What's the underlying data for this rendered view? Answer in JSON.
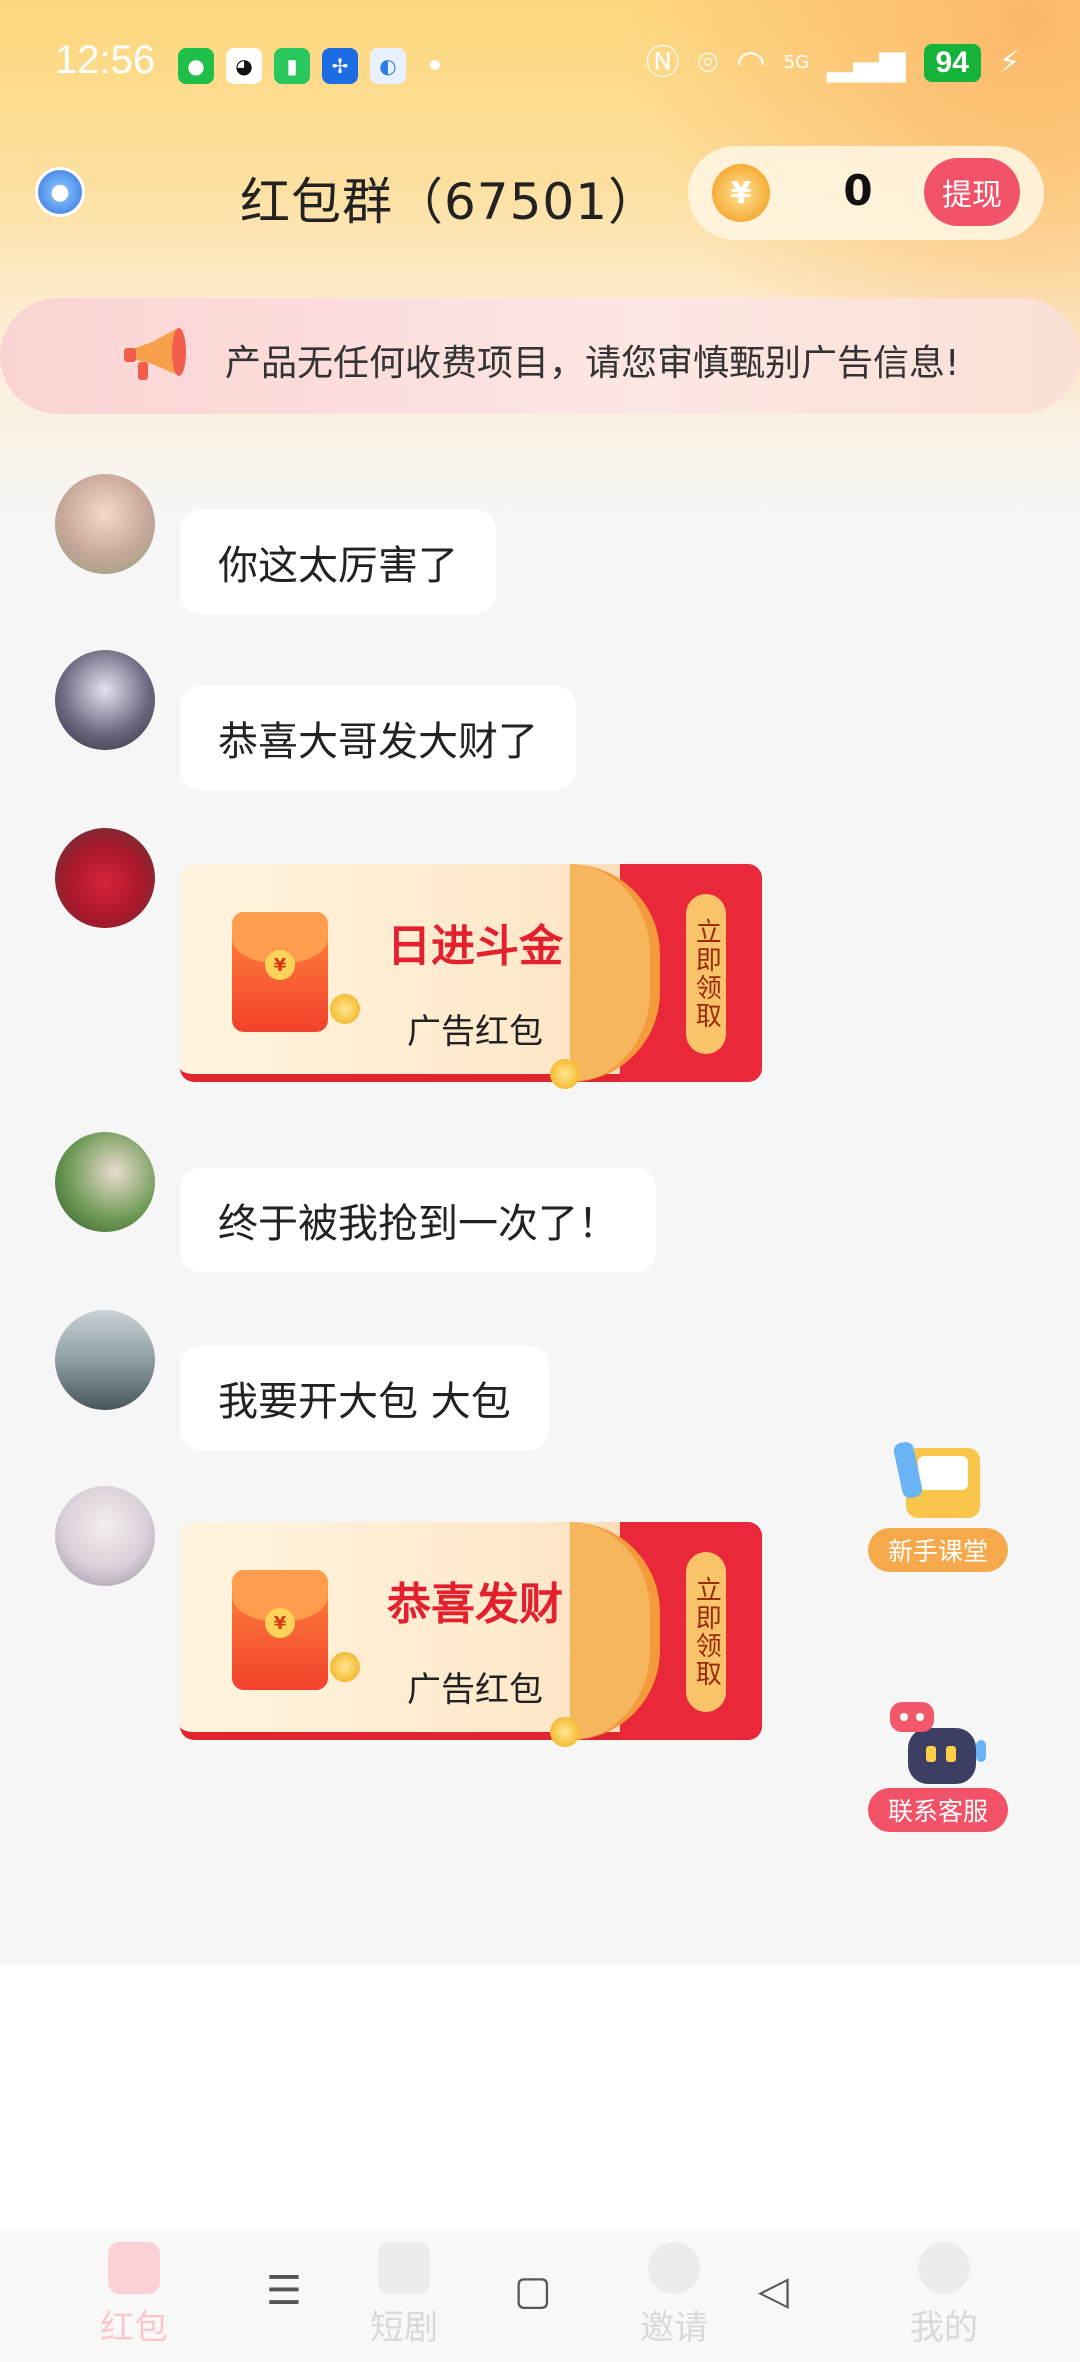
{
  "status_bar": {
    "time": "12:56",
    "battery": "94",
    "network": "5G"
  },
  "header": {
    "title": "红包群（67501）",
    "balance": "0",
    "withdraw_label": "提现"
  },
  "notice": {
    "text": "产品无任何收费项目，请您审慎甄别广告信息!"
  },
  "messages": [
    {
      "type": "text",
      "text": "你这太厉害了"
    },
    {
      "type": "text",
      "text": "恭喜大哥发大财了"
    },
    {
      "type": "packet",
      "title": "日进斗金",
      "subtitle": "广告红包",
      "button": "立即领取"
    },
    {
      "type": "text",
      "text": "终于被我抢到一次了！"
    },
    {
      "type": "text",
      "text": "我要开大包 大包"
    },
    {
      "type": "packet",
      "title": "恭喜发财",
      "subtitle": "广告红包",
      "button": "立即领取"
    }
  ],
  "floating": {
    "tutorial_label": "新手课堂",
    "support_label": "联系客服"
  },
  "tabs": [
    {
      "label": "红包",
      "icon": "red-packet-icon",
      "active": true
    },
    {
      "label": "短剧",
      "icon": "clapper-icon",
      "active": false
    },
    {
      "label": "邀请",
      "icon": "invite-user-icon",
      "active": false
    },
    {
      "label": "我的",
      "icon": "profile-icon",
      "active": false
    }
  ],
  "colors": {
    "accent_red": "#f25267",
    "packet_red": "#e3202e",
    "header_gold": "#fdd77c"
  }
}
